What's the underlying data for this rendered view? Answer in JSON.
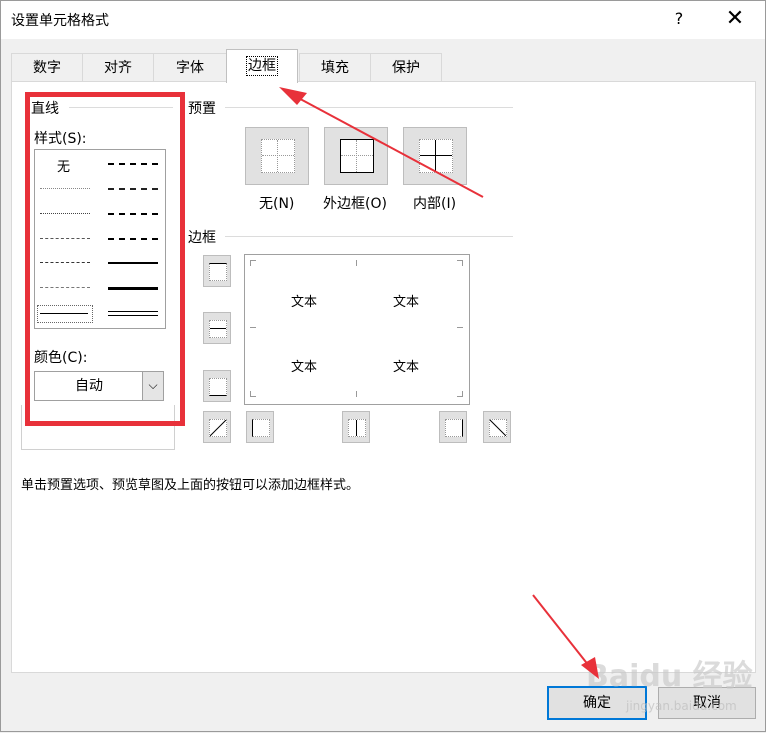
{
  "dialog": {
    "title": "设置单元格格式",
    "help": "?",
    "close": "✕"
  },
  "tabs": [
    "数字",
    "对齐",
    "字体",
    "边框",
    "填充",
    "保护"
  ],
  "active_tab": "边框",
  "line": {
    "group_label": "直线",
    "style_label": "样式(S):",
    "none_label": "无",
    "color_label": "颜色(C):",
    "color_value": "自动"
  },
  "presets": {
    "group_label": "预置",
    "none": "无(N)",
    "outline": "外边框(O)",
    "inside": "内部(I)"
  },
  "border": {
    "group_label": "边框",
    "preview_text": [
      "文本",
      "文本",
      "文本",
      "文本"
    ]
  },
  "hint": "单击预置选项、预览草图及上面的按钮可以添加边框样式。",
  "buttons": {
    "ok": "确定",
    "cancel": "取消"
  },
  "watermark": {
    "brand": "Baidu 经验",
    "url": "jingyan.baidu.com"
  },
  "colors": {
    "highlight": "#e8313a",
    "accent": "#0078d7"
  }
}
